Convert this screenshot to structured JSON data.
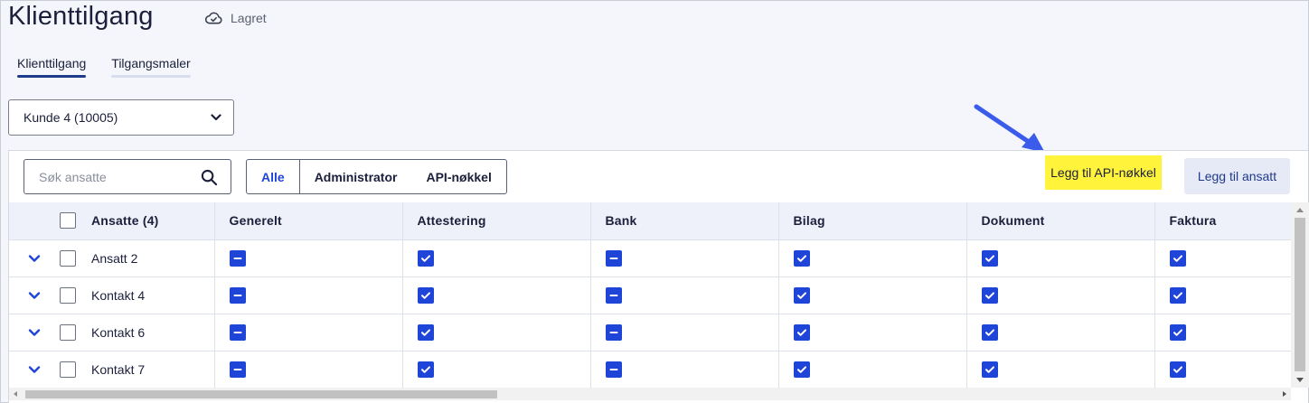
{
  "page": {
    "title": "Klienttilgang",
    "saved_status": "Lagret"
  },
  "tabs": [
    {
      "label": "Klienttilgang",
      "active": true
    },
    {
      "label": "Tilgangsmaler",
      "active": false
    }
  ],
  "client_select": {
    "value": "Kunde 4 (10005)"
  },
  "toolbar": {
    "search_placeholder": "Søk ansatte",
    "filters": [
      "Alle",
      "Administrator",
      "API-nøkkel"
    ],
    "active_filter": "Alle",
    "add_api_key_label": "Legg til API-nøkkel",
    "add_employee_label": "Legg til ansatt"
  },
  "table": {
    "header": {
      "name_column": "Ansatte (4)",
      "columns": [
        "Generelt",
        "Attestering",
        "Bank",
        "Bilag",
        "Dokument",
        "Faktura"
      ]
    },
    "rows": [
      {
        "name": "Ansatt 2",
        "states": [
          "partial",
          "checked",
          "partial",
          "checked",
          "checked",
          "checked"
        ]
      },
      {
        "name": "Kontakt 4",
        "states": [
          "partial",
          "checked",
          "partial",
          "checked",
          "checked",
          "checked"
        ]
      },
      {
        "name": "Kontakt 6",
        "states": [
          "partial",
          "checked",
          "partial",
          "checked",
          "checked",
          "checked"
        ]
      },
      {
        "name": "Kontakt 7",
        "states": [
          "partial",
          "checked",
          "partial",
          "checked",
          "checked",
          "checked"
        ]
      }
    ]
  },
  "colors": {
    "accent": "#1f44d8",
    "tab_underline": "#1e3a8a",
    "highlight": "#fff33b",
    "annotation_arrow": "#3b5bea"
  },
  "icons": {
    "saved": "cloud-check-icon",
    "select": "chevron-down-icon",
    "search": "search-icon",
    "row_expand": "chevron-down-icon",
    "checked": "checkbox-checked-icon",
    "partial": "checkbox-indeterminate-icon",
    "annotation": "arrow-icon"
  }
}
